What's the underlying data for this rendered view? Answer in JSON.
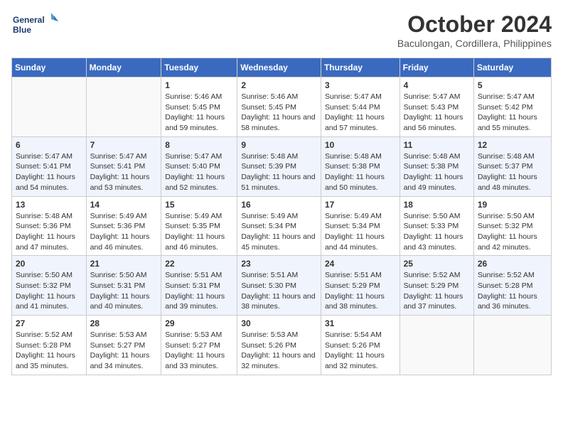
{
  "logo": {
    "line1": "General",
    "line2": "Blue"
  },
  "title": "October 2024",
  "location": "Baculongan, Cordillera, Philippines",
  "weekdays": [
    "Sunday",
    "Monday",
    "Tuesday",
    "Wednesday",
    "Thursday",
    "Friday",
    "Saturday"
  ],
  "weeks": [
    [
      {
        "day": null
      },
      {
        "day": null
      },
      {
        "day": "1",
        "sunrise": "5:46 AM",
        "sunset": "5:45 PM",
        "daylight": "11 hours and 59 minutes."
      },
      {
        "day": "2",
        "sunrise": "5:46 AM",
        "sunset": "5:45 PM",
        "daylight": "11 hours and 58 minutes."
      },
      {
        "day": "3",
        "sunrise": "5:47 AM",
        "sunset": "5:44 PM",
        "daylight": "11 hours and 57 minutes."
      },
      {
        "day": "4",
        "sunrise": "5:47 AM",
        "sunset": "5:43 PM",
        "daylight": "11 hours and 56 minutes."
      },
      {
        "day": "5",
        "sunrise": "5:47 AM",
        "sunset": "5:42 PM",
        "daylight": "11 hours and 55 minutes."
      }
    ],
    [
      {
        "day": "6",
        "sunrise": "5:47 AM",
        "sunset": "5:41 PM",
        "daylight": "11 hours and 54 minutes."
      },
      {
        "day": "7",
        "sunrise": "5:47 AM",
        "sunset": "5:41 PM",
        "daylight": "11 hours and 53 minutes."
      },
      {
        "day": "8",
        "sunrise": "5:47 AM",
        "sunset": "5:40 PM",
        "daylight": "11 hours and 52 minutes."
      },
      {
        "day": "9",
        "sunrise": "5:48 AM",
        "sunset": "5:39 PM",
        "daylight": "11 hours and 51 minutes."
      },
      {
        "day": "10",
        "sunrise": "5:48 AM",
        "sunset": "5:38 PM",
        "daylight": "11 hours and 50 minutes."
      },
      {
        "day": "11",
        "sunrise": "5:48 AM",
        "sunset": "5:38 PM",
        "daylight": "11 hours and 49 minutes."
      },
      {
        "day": "12",
        "sunrise": "5:48 AM",
        "sunset": "5:37 PM",
        "daylight": "11 hours and 48 minutes."
      }
    ],
    [
      {
        "day": "13",
        "sunrise": "5:48 AM",
        "sunset": "5:36 PM",
        "daylight": "11 hours and 47 minutes."
      },
      {
        "day": "14",
        "sunrise": "5:49 AM",
        "sunset": "5:36 PM",
        "daylight": "11 hours and 46 minutes."
      },
      {
        "day": "15",
        "sunrise": "5:49 AM",
        "sunset": "5:35 PM",
        "daylight": "11 hours and 46 minutes."
      },
      {
        "day": "16",
        "sunrise": "5:49 AM",
        "sunset": "5:34 PM",
        "daylight": "11 hours and 45 minutes."
      },
      {
        "day": "17",
        "sunrise": "5:49 AM",
        "sunset": "5:34 PM",
        "daylight": "11 hours and 44 minutes."
      },
      {
        "day": "18",
        "sunrise": "5:50 AM",
        "sunset": "5:33 PM",
        "daylight": "11 hours and 43 minutes."
      },
      {
        "day": "19",
        "sunrise": "5:50 AM",
        "sunset": "5:32 PM",
        "daylight": "11 hours and 42 minutes."
      }
    ],
    [
      {
        "day": "20",
        "sunrise": "5:50 AM",
        "sunset": "5:32 PM",
        "daylight": "11 hours and 41 minutes."
      },
      {
        "day": "21",
        "sunrise": "5:50 AM",
        "sunset": "5:31 PM",
        "daylight": "11 hours and 40 minutes."
      },
      {
        "day": "22",
        "sunrise": "5:51 AM",
        "sunset": "5:31 PM",
        "daylight": "11 hours and 39 minutes."
      },
      {
        "day": "23",
        "sunrise": "5:51 AM",
        "sunset": "5:30 PM",
        "daylight": "11 hours and 38 minutes."
      },
      {
        "day": "24",
        "sunrise": "5:51 AM",
        "sunset": "5:29 PM",
        "daylight": "11 hours and 38 minutes."
      },
      {
        "day": "25",
        "sunrise": "5:52 AM",
        "sunset": "5:29 PM",
        "daylight": "11 hours and 37 minutes."
      },
      {
        "day": "26",
        "sunrise": "5:52 AM",
        "sunset": "5:28 PM",
        "daylight": "11 hours and 36 minutes."
      }
    ],
    [
      {
        "day": "27",
        "sunrise": "5:52 AM",
        "sunset": "5:28 PM",
        "daylight": "11 hours and 35 minutes."
      },
      {
        "day": "28",
        "sunrise": "5:53 AM",
        "sunset": "5:27 PM",
        "daylight": "11 hours and 34 minutes."
      },
      {
        "day": "29",
        "sunrise": "5:53 AM",
        "sunset": "5:27 PM",
        "daylight": "11 hours and 33 minutes."
      },
      {
        "day": "30",
        "sunrise": "5:53 AM",
        "sunset": "5:26 PM",
        "daylight": "11 hours and 32 minutes."
      },
      {
        "day": "31",
        "sunrise": "5:54 AM",
        "sunset": "5:26 PM",
        "daylight": "11 hours and 32 minutes."
      },
      {
        "day": null
      },
      {
        "day": null
      }
    ]
  ]
}
